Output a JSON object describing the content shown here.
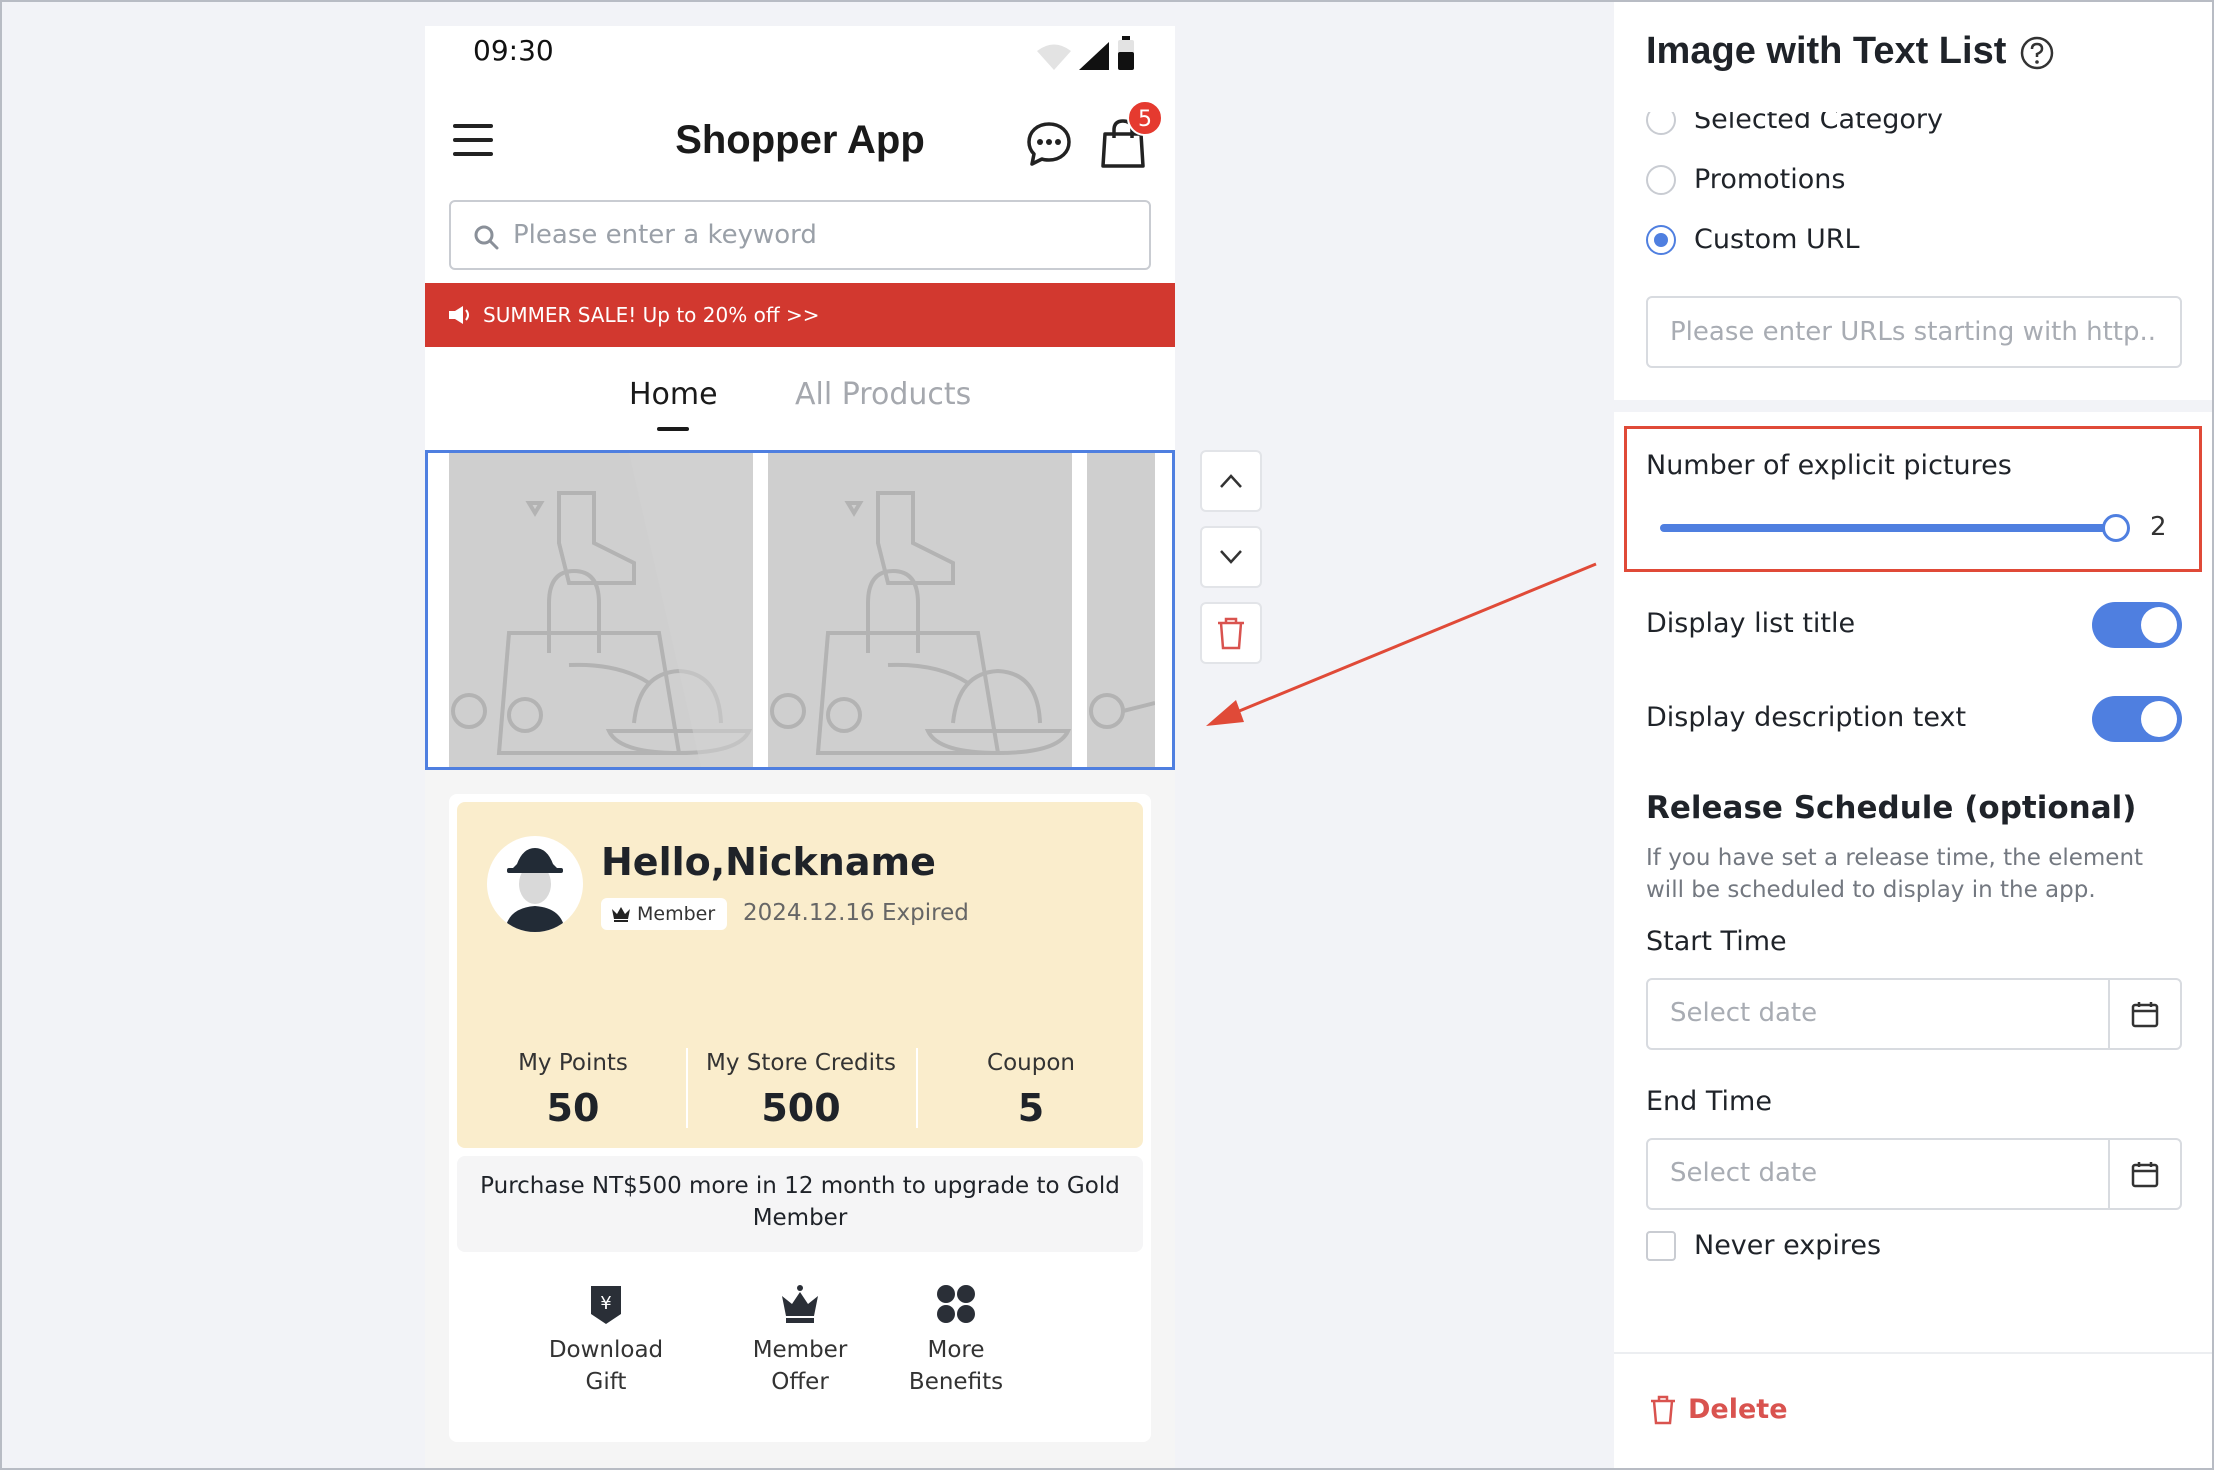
{
  "phone": {
    "status_time": "09:30",
    "app_title": "Shopper App",
    "cart_count": "5",
    "search_placeholder": "Please enter a keyword",
    "banner_text": "SUMMER SALE! Up to 20% off >>",
    "tabs": [
      {
        "label": "Home",
        "active": true
      },
      {
        "label": "All Products",
        "active": false
      }
    ],
    "member": {
      "greeting": "Hello,Nickname",
      "tier": "Member",
      "expiry": "2024.12.16 Expired",
      "stats": [
        {
          "label": "My Points",
          "value": "50"
        },
        {
          "label": "My Store Credits",
          "value": "500"
        },
        {
          "label": "Coupon",
          "value": "5"
        }
      ],
      "upgrade_text": "Purchase NT$500 more in 12 month to upgrade to Gold Member",
      "benefits": [
        {
          "line1": "Download",
          "line2": "Gift",
          "icon": "gift-tag-icon"
        },
        {
          "line1": "Member",
          "line2": "Offer",
          "icon": "crown-icon"
        },
        {
          "line1": "More",
          "line2": "Benefits",
          "icon": "grid-icon"
        }
      ]
    }
  },
  "panel": {
    "title": "Image with Text List",
    "link_options": [
      {
        "label": "Selected Category",
        "checked": false
      },
      {
        "label": "Promotions",
        "checked": false
      },
      {
        "label": "Custom URL",
        "checked": true
      }
    ],
    "url_placeholder": "Please enter URLs starting with http...",
    "explicit_pictures_label": "Number of explicit pictures",
    "explicit_pictures_value": "2",
    "display_list_title_label": "Display list title",
    "display_description_label": "Display description text",
    "schedule_title": "Release Schedule (optional)",
    "schedule_desc": "If you have set a release time, the element will be scheduled to display in the app.",
    "start_time_label": "Start Time",
    "end_time_label": "End Time",
    "date_placeholder": "Select date",
    "never_expires_label": "Never expires",
    "delete_label": "Delete"
  },
  "colors": {
    "accent": "#4f7fe0",
    "banner": "#d2382f",
    "highlight": "#e04a38",
    "member_bg": "#faedcc"
  }
}
